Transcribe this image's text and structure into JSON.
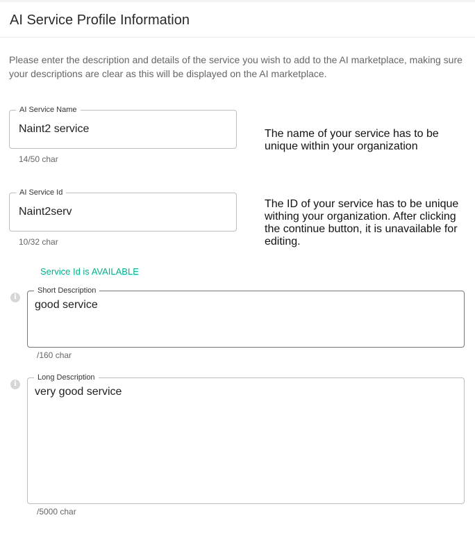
{
  "header": {
    "title": "AI Service Profile Information"
  },
  "intro": "Please enter the description and details of the service you wish to add to the AI marketplace, making sure your descriptions are clear as this will be displayed on the AI marketplace.",
  "service_name": {
    "label": "AI Service Name",
    "value": "Naint2 service",
    "count": "14/50 char",
    "helper": "The name of your service has to be unique within your organization"
  },
  "service_id": {
    "label": "AI Service Id",
    "value": "Naint2serv",
    "count": "10/32 char",
    "helper": "The ID of your service has to be unique withing your organization. After clicking the continue button, it is unavailable for editing.",
    "status": "Service Id is AVAILABLE"
  },
  "short_description": {
    "label": "Short Description",
    "value": "good service",
    "count": "/160 char"
  },
  "long_description": {
    "label": "Long Description",
    "value": "very good service",
    "count": "/5000 char"
  },
  "colors": {
    "status_green": "#00b386",
    "info_icon": "#d6d6d6"
  }
}
